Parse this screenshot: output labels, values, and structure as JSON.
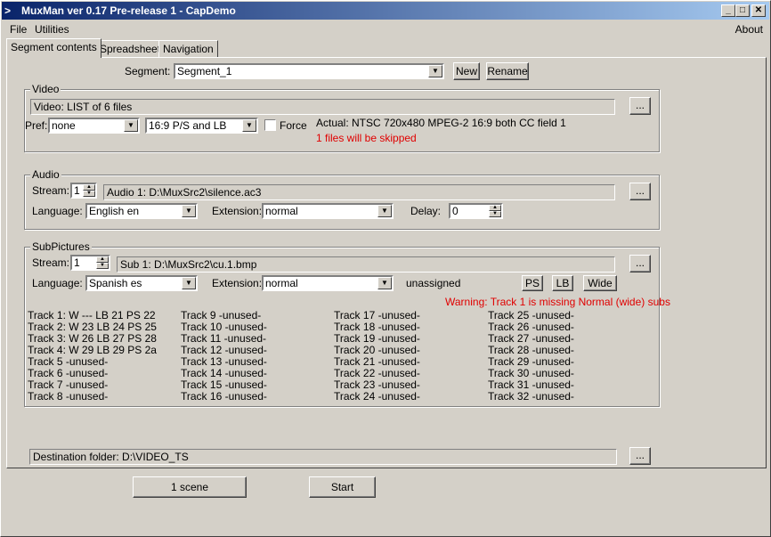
{
  "window": {
    "title": "MuxMan ver 0.17 Pre-release 1 - CapDemo",
    "sys_icon": ">"
  },
  "menu": {
    "file": "File",
    "utilities": "Utilities",
    "about": "About"
  },
  "tabs": [
    "Segment contents",
    "Spreadsheet",
    "Navigation"
  ],
  "segment": {
    "label": "Segment:",
    "value": "Segment_1",
    "new_btn": "New",
    "rename_btn": "Rename"
  },
  "video": {
    "group": "Video",
    "list": "Video: LIST of 6 files",
    "browse": "...",
    "pref_label": "Pref:",
    "pref_value": "none",
    "aspect_value": "16:9 P/S and LB",
    "force_label": "Force",
    "actual": "Actual: NTSC 720x480  MPEG-2  16:9 both  CC field 1",
    "skipped": "1 files will be skipped"
  },
  "audio": {
    "group": "Audio",
    "stream_label": "Stream:",
    "stream_value": "1",
    "file": "Audio 1: D:\\MuxSrc2\\silence.ac3",
    "browse": "...",
    "language_label": "Language:",
    "language_value": "English en",
    "extension_label": "Extension:",
    "extension_value": "normal",
    "delay_label": "Delay:",
    "delay_value": "0"
  },
  "subpictures": {
    "group": "SubPictures",
    "stream_label": "Stream:",
    "stream_value": "1",
    "file": "Sub 1: D:\\MuxSrc2\\cu.1.bmp",
    "browse": "...",
    "language_label": "Language:",
    "language_value": "Spanish es",
    "extension_label": "Extension:",
    "extension_value": "normal",
    "unassigned": "unassigned",
    "ps_btn": "PS",
    "lb_btn": "LB",
    "wide_btn": "Wide",
    "warning": "Warning: Track 1 is missing Normal (wide) subs",
    "tracks": [
      "Track 1:  W ---  LB 21  PS 22",
      "Track 2:  W 23  LB 24  PS 25",
      "Track 3:  W 26  LB 27  PS 28",
      "Track 4:  W 29  LB 29  PS 2a",
      "Track 5  -unused-",
      "Track 6  -unused-",
      "Track 7  -unused-",
      "Track 8  -unused-",
      "Track 9  -unused-",
      "Track 10  -unused-",
      "Track 11  -unused-",
      "Track 12  -unused-",
      "Track 13  -unused-",
      "Track 14  -unused-",
      "Track 15  -unused-",
      "Track 16  -unused-",
      "Track 17  -unused-",
      "Track 18  -unused-",
      "Track 19  -unused-",
      "Track 20  -unused-",
      "Track 21  -unused-",
      "Track 22  -unused-",
      "Track 23  -unused-",
      "Track 24  -unused-",
      "Track 25  -unused-",
      "Track 26  -unused-",
      "Track 27  -unused-",
      "Track 28  -unused-",
      "Track 29  -unused-",
      "Track 30  -unused-",
      "Track 31  -unused-",
      "Track 32  -unused-"
    ]
  },
  "destination": {
    "text": "Destination folder: D:\\VIDEO_TS",
    "browse": "..."
  },
  "footer": {
    "scene_btn": "1 scene",
    "start_btn": "Start"
  },
  "colors": {
    "title_start": "#0a246a",
    "title_end": "#a6caf0",
    "warning": "#e00000",
    "face": "#d4d0c8"
  }
}
